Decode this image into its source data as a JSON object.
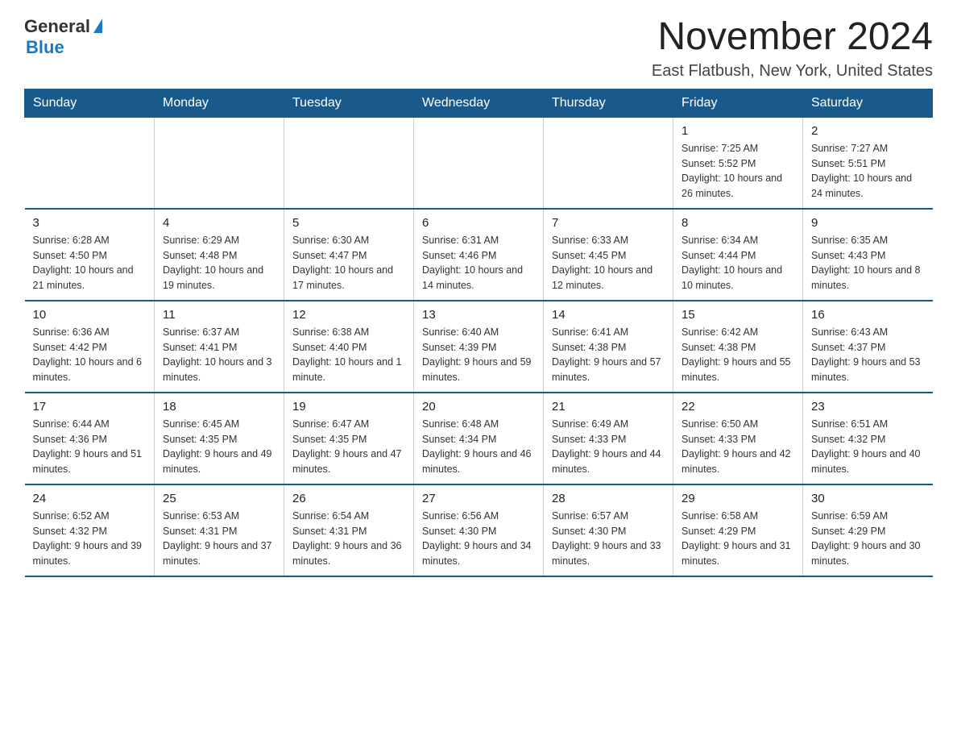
{
  "header": {
    "logo_general": "General",
    "logo_blue": "Blue",
    "month_title": "November 2024",
    "location": "East Flatbush, New York, United States"
  },
  "days_of_week": [
    "Sunday",
    "Monday",
    "Tuesday",
    "Wednesday",
    "Thursday",
    "Friday",
    "Saturday"
  ],
  "weeks": [
    [
      {
        "day": "",
        "info": ""
      },
      {
        "day": "",
        "info": ""
      },
      {
        "day": "",
        "info": ""
      },
      {
        "day": "",
        "info": ""
      },
      {
        "day": "",
        "info": ""
      },
      {
        "day": "1",
        "info": "Sunrise: 7:25 AM\nSunset: 5:52 PM\nDaylight: 10 hours and 26 minutes."
      },
      {
        "day": "2",
        "info": "Sunrise: 7:27 AM\nSunset: 5:51 PM\nDaylight: 10 hours and 24 minutes."
      }
    ],
    [
      {
        "day": "3",
        "info": "Sunrise: 6:28 AM\nSunset: 4:50 PM\nDaylight: 10 hours and 21 minutes."
      },
      {
        "day": "4",
        "info": "Sunrise: 6:29 AM\nSunset: 4:48 PM\nDaylight: 10 hours and 19 minutes."
      },
      {
        "day": "5",
        "info": "Sunrise: 6:30 AM\nSunset: 4:47 PM\nDaylight: 10 hours and 17 minutes."
      },
      {
        "day": "6",
        "info": "Sunrise: 6:31 AM\nSunset: 4:46 PM\nDaylight: 10 hours and 14 minutes."
      },
      {
        "day": "7",
        "info": "Sunrise: 6:33 AM\nSunset: 4:45 PM\nDaylight: 10 hours and 12 minutes."
      },
      {
        "day": "8",
        "info": "Sunrise: 6:34 AM\nSunset: 4:44 PM\nDaylight: 10 hours and 10 minutes."
      },
      {
        "day": "9",
        "info": "Sunrise: 6:35 AM\nSunset: 4:43 PM\nDaylight: 10 hours and 8 minutes."
      }
    ],
    [
      {
        "day": "10",
        "info": "Sunrise: 6:36 AM\nSunset: 4:42 PM\nDaylight: 10 hours and 6 minutes."
      },
      {
        "day": "11",
        "info": "Sunrise: 6:37 AM\nSunset: 4:41 PM\nDaylight: 10 hours and 3 minutes."
      },
      {
        "day": "12",
        "info": "Sunrise: 6:38 AM\nSunset: 4:40 PM\nDaylight: 10 hours and 1 minute."
      },
      {
        "day": "13",
        "info": "Sunrise: 6:40 AM\nSunset: 4:39 PM\nDaylight: 9 hours and 59 minutes."
      },
      {
        "day": "14",
        "info": "Sunrise: 6:41 AM\nSunset: 4:38 PM\nDaylight: 9 hours and 57 minutes."
      },
      {
        "day": "15",
        "info": "Sunrise: 6:42 AM\nSunset: 4:38 PM\nDaylight: 9 hours and 55 minutes."
      },
      {
        "day": "16",
        "info": "Sunrise: 6:43 AM\nSunset: 4:37 PM\nDaylight: 9 hours and 53 minutes."
      }
    ],
    [
      {
        "day": "17",
        "info": "Sunrise: 6:44 AM\nSunset: 4:36 PM\nDaylight: 9 hours and 51 minutes."
      },
      {
        "day": "18",
        "info": "Sunrise: 6:45 AM\nSunset: 4:35 PM\nDaylight: 9 hours and 49 minutes."
      },
      {
        "day": "19",
        "info": "Sunrise: 6:47 AM\nSunset: 4:35 PM\nDaylight: 9 hours and 47 minutes."
      },
      {
        "day": "20",
        "info": "Sunrise: 6:48 AM\nSunset: 4:34 PM\nDaylight: 9 hours and 46 minutes."
      },
      {
        "day": "21",
        "info": "Sunrise: 6:49 AM\nSunset: 4:33 PM\nDaylight: 9 hours and 44 minutes."
      },
      {
        "day": "22",
        "info": "Sunrise: 6:50 AM\nSunset: 4:33 PM\nDaylight: 9 hours and 42 minutes."
      },
      {
        "day": "23",
        "info": "Sunrise: 6:51 AM\nSunset: 4:32 PM\nDaylight: 9 hours and 40 minutes."
      }
    ],
    [
      {
        "day": "24",
        "info": "Sunrise: 6:52 AM\nSunset: 4:32 PM\nDaylight: 9 hours and 39 minutes."
      },
      {
        "day": "25",
        "info": "Sunrise: 6:53 AM\nSunset: 4:31 PM\nDaylight: 9 hours and 37 minutes."
      },
      {
        "day": "26",
        "info": "Sunrise: 6:54 AM\nSunset: 4:31 PM\nDaylight: 9 hours and 36 minutes."
      },
      {
        "day": "27",
        "info": "Sunrise: 6:56 AM\nSunset: 4:30 PM\nDaylight: 9 hours and 34 minutes."
      },
      {
        "day": "28",
        "info": "Sunrise: 6:57 AM\nSunset: 4:30 PM\nDaylight: 9 hours and 33 minutes."
      },
      {
        "day": "29",
        "info": "Sunrise: 6:58 AM\nSunset: 4:29 PM\nDaylight: 9 hours and 31 minutes."
      },
      {
        "day": "30",
        "info": "Sunrise: 6:59 AM\nSunset: 4:29 PM\nDaylight: 9 hours and 30 minutes."
      }
    ]
  ]
}
